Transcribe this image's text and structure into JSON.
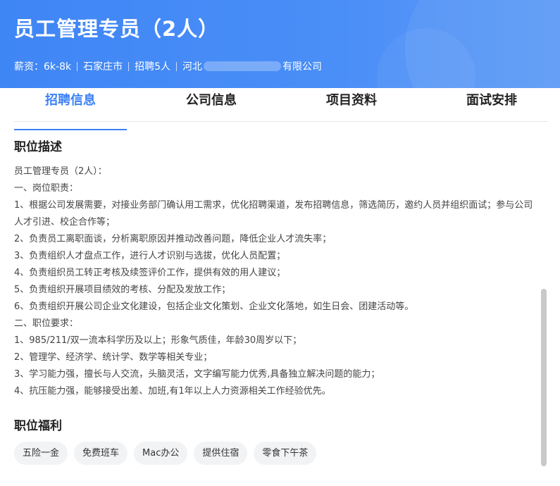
{
  "header": {
    "title": "员工管理专员（2人）",
    "salary": "薪资：6k-8k",
    "city": "石家庄市",
    "headcount": "招聘5人",
    "company_prefix": "河北",
    "company_suffix": "有限公司",
    "gradient_color": "#4a8ef7"
  },
  "tabs": [
    "招聘信息",
    "公司信息",
    "项目资料",
    "面试安排"
  ],
  "active_tab": "招聘信息",
  "description": {
    "title": "职位描述",
    "lines": [
      "员工管理专员（2人）：",
      "一、岗位职责：",
      "1、根据公司发展需要，对接业务部门确认用工需求，优化招聘渠道，发布招聘信息，筛选简历，邀约人员并组织面试；参与公司人才引进、校企合作等；",
      "2、负责员工离职面谈，分析离职原因并推动改善问题，降低企业人才流失率；",
      "3、负责组织人才盘点工作，进行人才识别与选拔，优化人员配置；",
      "4、负责组织员工转正考核及续签评价工作，提供有效的用人建议；",
      "5、负责组织开展项目绩效的考核、分配及发放工作；",
      "6、负责组织开展公司企业文化建设，包括企业文化策划、企业文化落地，如生日会、团建活动等。",
      "二、职位要求：",
      "1、985/211/双一流本科学历及以上；形象气质佳，年龄30周岁以下；",
      "2、管理学、经济学、统计学、数学等相关专业；",
      "3、学习能力强，擅长与人交流，头脑灵活，文字编写能力优秀,具备独立解决问题的能力；",
      "4、抗压能力强，能够接受出差、加班,有1年以上人力资源相关工作经验优先。"
    ]
  },
  "benefits": {
    "title": "职位福利",
    "tags": [
      "五险一金",
      "免费班车",
      "Mac办公",
      "提供住宿",
      "零食下午茶"
    ]
  },
  "accent_color": "#3b82f6"
}
